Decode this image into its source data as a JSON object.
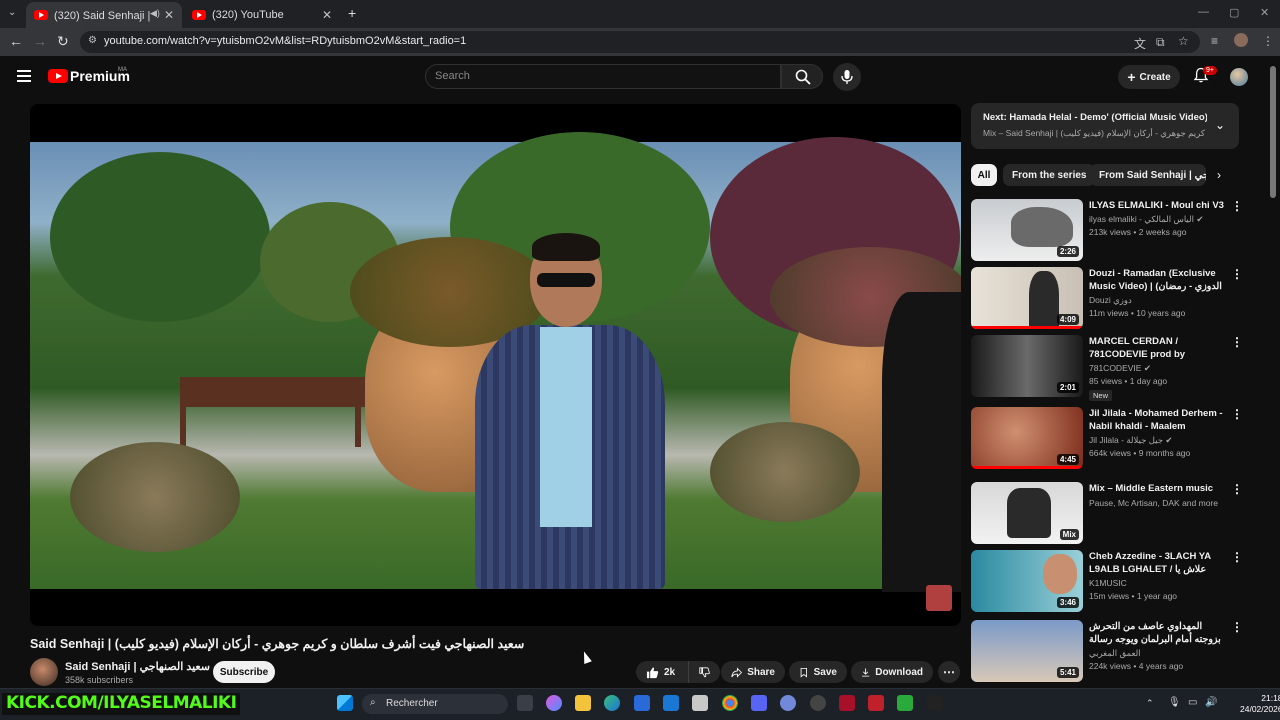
{
  "browser": {
    "tabs": [
      {
        "title": "(320) Said Senhaji | سعيد الصنهاجي | فيديو كليب",
        "active": true
      },
      {
        "title": "(320) YouTube",
        "active": false
      }
    ],
    "new_tab": "+",
    "url": "youtube.com/watch?v=ytuisbmO2vM&list=RDytuisbmO2vM&start_radio=1"
  },
  "header": {
    "logo_text": "Premium",
    "country_code": "MA",
    "search_placeholder": "Search",
    "create_label": "Create",
    "notifications_badge": "9+"
  },
  "video": {
    "title": "Said Senhaji | سعيد الصنهاجي فيت أشرف سلطان و كريم جوهري - أركان الإسلام (فيديو كليب)",
    "channel_name": "Said Senhaji | سعيد الصنهاجي",
    "subscribers": "358k subscribers",
    "subscribe_label": "Subscribe",
    "likes": "2k",
    "share_label": "Share",
    "save_label": "Save",
    "download_label": "Download"
  },
  "up_next": {
    "title": "Next: Hamada Helal - Demo' (Official Music Video) / ...",
    "subtitle": "Mix – Said Senhaji | سعيد الصنهاجي فيت أشرف سلطان و كريم جوهري - أركان الإسلام (فيديو كليب)"
  },
  "chips": [
    "All",
    "From the series",
    "From Said Senhaji | سعيد الصنهاجي"
  ],
  "recommendations": [
    {
      "title": "ILYAS ELMALIKI - Moul chi V3",
      "channel": "ilyas elmaliki - الياس المالكي",
      "meta": "213k views • 2 weeks ago",
      "duration": "2:26",
      "verified": true
    },
    {
      "title": "Douzi - Ramadan (Exclusive Music Video) | (الدوزي - رمضان (فيديو كليب",
      "channel": "Douzi دوزي",
      "meta": "11m views • 10 years ago",
      "duration": "4:09",
      "verified": false
    },
    {
      "title": "MARCEL CERDAN / 781CODEVIE prod by outbreakz",
      "channel": "781CODEVIE",
      "meta": "85 views • 1 day ago",
      "duration": "2:01",
      "verified": true,
      "badge": "New"
    },
    {
      "title": "Jil Jilala - Mohamed Derhem - Nabil khaldi - Maalem Mustafa...",
      "channel": "Jil Jilala - جيل جيلالة",
      "meta": "664k views • 9 months ago",
      "duration": "4:45",
      "verified": true
    },
    {
      "title": "Mix – Middle Eastern music",
      "channel": "Pause, Mc Artisan, DAK and more",
      "meta": "",
      "duration": "Mix",
      "verified": false
    },
    {
      "title": "Cheb Azzedine - 3LACH YA L9ALB LGHALET / علاش يا القلب الغالط",
      "channel": "K1MUSIC",
      "meta": "15m views • 1 year ago",
      "duration": "3:46",
      "verified": false
    },
    {
      "title": "المهداوي عاصف من التحرش بزوجته أمام البرلمان ويوجه رسالة قوية للمسؤولين",
      "channel": "العمق المغربي",
      "meta": "224k views • 4 years ago",
      "duration": "5:41",
      "verified": false
    }
  ],
  "taskbar": {
    "overlay_text": "KICK.COM/ILYASELMALIKI",
    "search_label": "Rechercher",
    "time": "21:18",
    "date": "24/02/2026"
  },
  "colors": {
    "background": "#0f0f0f",
    "brand_red": "#ff0000",
    "chip_bg": "#272727",
    "kick_green": "#53fc18"
  }
}
